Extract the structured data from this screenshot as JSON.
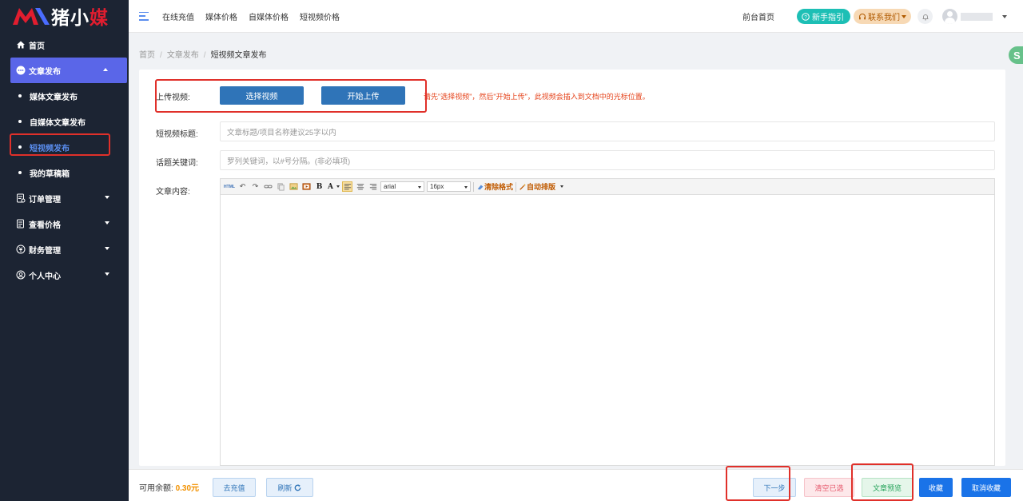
{
  "brand": {
    "name_part1": "猪",
    "name_part2": "小",
    "name_part3": "媒"
  },
  "sidebar": {
    "home": "首页",
    "article_publish": "文章发布",
    "sub_items": [
      "媒体文章发布",
      "自媒体文章发布",
      "短视频发布",
      "我的草稿箱"
    ],
    "orders": "订单管理",
    "prices": "查看价格",
    "finance": "财务管理",
    "personal": "个人中心"
  },
  "header": {
    "links": [
      "在线充值",
      "媒体价格",
      "自媒体价格",
      "短视频价格"
    ],
    "front_home": "前台首页",
    "guide": "新手指引",
    "contact": "联系我们"
  },
  "breadcrumb": {
    "home": "首页",
    "section": "文章发布",
    "current": "短视频文章发布"
  },
  "float_badge": "S",
  "form": {
    "upload_label": "上传视频:",
    "select_video": "选择视频",
    "start_upload": "开始上传",
    "hint": "请先\"选择视频\"，然后\"开始上传\"，此视频会插入到文档中的光标位置。",
    "title_label": "短视频标题:",
    "title_placeholder": "文章标题/项目名称建议25字以内",
    "keywords_label": "话题关键词:",
    "keywords_placeholder": "罗列关键词，以#号分隔。(非必填项)",
    "content_label": "文章内容:"
  },
  "editor": {
    "html_btn": "HTML",
    "bold": "B",
    "font_color": "A",
    "font_family": "arial",
    "font_size": "16px",
    "clear_format": "清除格式",
    "auto_layout": "自动排版"
  },
  "footer": {
    "balance_label": "可用余额:",
    "balance_value": "0.30元",
    "recharge": "去充值",
    "refresh": "刷新",
    "next": "下一步",
    "clear_selected": "清空已选",
    "preview": "文章预览",
    "favorite": "收藏",
    "unfavorite": "取消收藏"
  },
  "colors": {
    "sidebar_bg": "#1c2433",
    "active": "#5a66e8",
    "primary": "#2f74b8",
    "highlight_box": "#e0302a"
  }
}
